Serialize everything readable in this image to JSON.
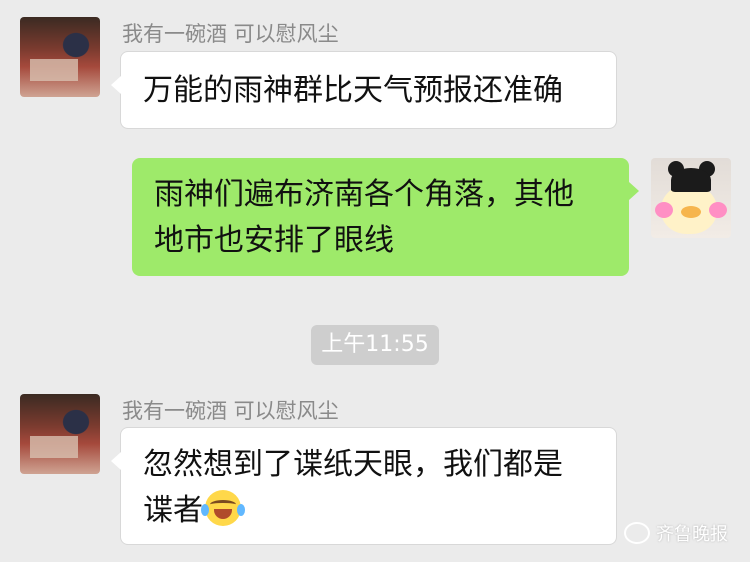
{
  "messages": [
    {
      "side": "left",
      "sender": "我有一碗酒  可以慰风尘",
      "text": "万能的雨神群比天气预报还准确"
    },
    {
      "side": "right",
      "text_line1": "雨神们遍布济南各个角落，其他",
      "text_line2": "地市也安排了眼线"
    },
    {
      "side": "left",
      "sender": "我有一碗酒  可以慰风尘",
      "text_line1": "忽然想到了谍纸天眼，我们都是",
      "text_line2": "谍者",
      "emoji": "laughing-tears-emoji"
    }
  ],
  "timestamp": "上午11:55",
  "watermark": "齐鲁晚报",
  "colors": {
    "background": "#ebebeb",
    "right_bubble": "#9eea6a",
    "left_bubble": "#ffffff"
  }
}
